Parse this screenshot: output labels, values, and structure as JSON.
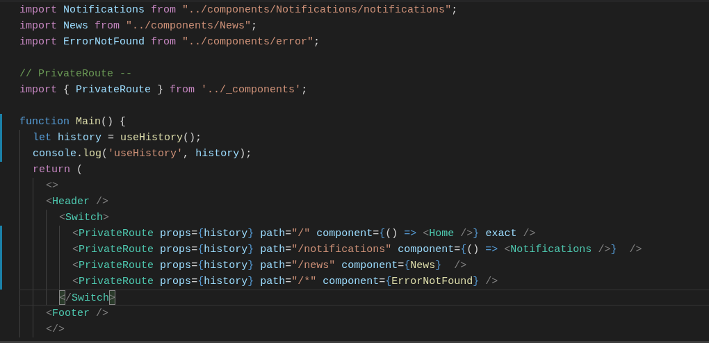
{
  "editor": {
    "lines": [
      {
        "changed": false,
        "current": false,
        "tokens": [
          {
            "text": "import",
            "kind": "keyword"
          },
          {
            "text": " Notifications",
            "kind": "variable"
          },
          {
            "text": " from",
            "kind": "keyword"
          },
          {
            "text": " \"../components/Notifications/notifications\"",
            "kind": "string"
          },
          {
            "text": ";",
            "kind": "punct"
          }
        ]
      },
      {
        "changed": false,
        "current": false,
        "tokens": [
          {
            "text": "import",
            "kind": "keyword"
          },
          {
            "text": " News",
            "kind": "variable"
          },
          {
            "text": " from",
            "kind": "keyword"
          },
          {
            "text": " \"../components/News\"",
            "kind": "string"
          },
          {
            "text": ";",
            "kind": "punct"
          }
        ]
      },
      {
        "changed": false,
        "current": false,
        "tokens": [
          {
            "text": "import",
            "kind": "keyword"
          },
          {
            "text": " ErrorNotFound",
            "kind": "variable"
          },
          {
            "text": " from",
            "kind": "keyword"
          },
          {
            "text": " \"../components/error\"",
            "kind": "string"
          },
          {
            "text": ";",
            "kind": "punct"
          }
        ]
      },
      {
        "changed": false,
        "current": false
      },
      {
        "changed": false,
        "current": false,
        "tokens": [
          {
            "text": "// PrivateRoute --",
            "kind": "comment"
          }
        ]
      },
      {
        "changed": false,
        "current": false,
        "tokens": [
          {
            "text": "import",
            "kind": "keyword"
          },
          {
            "text": " {",
            "kind": "punct"
          },
          {
            "text": " PrivateRoute",
            "kind": "variable"
          },
          {
            "text": " }",
            "kind": "punct"
          },
          {
            "text": " from",
            "kind": "keyword"
          },
          {
            "text": " '../_components'",
            "kind": "string"
          },
          {
            "text": ";",
            "kind": "punct"
          }
        ]
      },
      {
        "changed": false,
        "current": false
      },
      {
        "changed": true,
        "current": false,
        "tokens": [
          {
            "text": "function",
            "kind": "storage"
          },
          {
            "text": " Main",
            "kind": "func"
          },
          {
            "text": "() {",
            "kind": "punct"
          }
        ]
      },
      {
        "changed": true,
        "current": false,
        "tokens": [
          {
            "text": "  let",
            "kind": "storage"
          },
          {
            "text": " history",
            "kind": "variable"
          },
          {
            "text": " =",
            "kind": "punct"
          },
          {
            "text": " useHistory",
            "kind": "func"
          },
          {
            "text": "();",
            "kind": "punct"
          }
        ]
      },
      {
        "changed": true,
        "current": false,
        "tokens": [
          {
            "text": "  console",
            "kind": "variable"
          },
          {
            "text": ".",
            "kind": "punct"
          },
          {
            "text": "log",
            "kind": "func"
          },
          {
            "text": "(",
            "kind": "punct"
          },
          {
            "text": "'useHistory'",
            "kind": "string"
          },
          {
            "text": ", ",
            "kind": "punct"
          },
          {
            "text": "history",
            "kind": "variable"
          },
          {
            "text": ");",
            "kind": "punct"
          }
        ]
      },
      {
        "changed": false,
        "current": false,
        "tokens": [
          {
            "text": "  return",
            "kind": "keyword"
          },
          {
            "text": " (",
            "kind": "punct"
          }
        ]
      },
      {
        "changed": false,
        "current": false,
        "tokens": [
          {
            "text": "    <>",
            "kind": "tagpunct"
          }
        ]
      },
      {
        "changed": false,
        "current": false,
        "tokens": [
          {
            "text": "    <",
            "kind": "tagpunct"
          },
          {
            "text": "Header",
            "kind": "tag"
          },
          {
            "text": " />",
            "kind": "tagpunct"
          }
        ]
      },
      {
        "changed": false,
        "current": false,
        "tokens": [
          {
            "text": "      <",
            "kind": "tagpunct"
          },
          {
            "text": "Switch",
            "kind": "tag"
          },
          {
            "text": ">",
            "kind": "tagpunct"
          }
        ]
      },
      {
        "changed": true,
        "current": false,
        "tokens": [
          {
            "text": "        <",
            "kind": "tagpunct"
          },
          {
            "text": "PrivateRoute",
            "kind": "tag"
          },
          {
            "text": " props",
            "kind": "variable"
          },
          {
            "text": "=",
            "kind": "punct"
          },
          {
            "text": "{",
            "kind": "brace"
          },
          {
            "text": "history",
            "kind": "variable"
          },
          {
            "text": "}",
            "kind": "brace"
          },
          {
            "text": " path",
            "kind": "variable"
          },
          {
            "text": "=",
            "kind": "punct"
          },
          {
            "text": "\"/\"",
            "kind": "string"
          },
          {
            "text": " component",
            "kind": "variable"
          },
          {
            "text": "=",
            "kind": "punct"
          },
          {
            "text": "{",
            "kind": "brace"
          },
          {
            "text": "()",
            "kind": "punct"
          },
          {
            "text": " =>",
            "kind": "storage"
          },
          {
            "text": " <",
            "kind": "tagpunct"
          },
          {
            "text": "Home",
            "kind": "tag"
          },
          {
            "text": " />",
            "kind": "tagpunct"
          },
          {
            "text": "}",
            "kind": "brace"
          },
          {
            "text": " exact",
            "kind": "variable"
          },
          {
            "text": " />",
            "kind": "tagpunct"
          }
        ]
      },
      {
        "changed": true,
        "current": false,
        "tokens": [
          {
            "text": "        <",
            "kind": "tagpunct"
          },
          {
            "text": "PrivateRoute",
            "kind": "tag"
          },
          {
            "text": " props",
            "kind": "variable"
          },
          {
            "text": "=",
            "kind": "punct"
          },
          {
            "text": "{",
            "kind": "brace"
          },
          {
            "text": "history",
            "kind": "variable"
          },
          {
            "text": "}",
            "kind": "brace"
          },
          {
            "text": " path",
            "kind": "variable"
          },
          {
            "text": "=",
            "kind": "punct"
          },
          {
            "text": "\"/notifications\"",
            "kind": "string"
          },
          {
            "text": " component",
            "kind": "variable"
          },
          {
            "text": "=",
            "kind": "punct"
          },
          {
            "text": "{",
            "kind": "brace"
          },
          {
            "text": "()",
            "kind": "punct"
          },
          {
            "text": " =>",
            "kind": "storage"
          },
          {
            "text": " <",
            "kind": "tagpunct"
          },
          {
            "text": "Notifications",
            "kind": "tag"
          },
          {
            "text": " />",
            "kind": "tagpunct"
          },
          {
            "text": "}",
            "kind": "brace"
          },
          {
            "text": "  />",
            "kind": "tagpunct"
          }
        ]
      },
      {
        "changed": true,
        "current": false,
        "tokens": [
          {
            "text": "        <",
            "kind": "tagpunct"
          },
          {
            "text": "PrivateRoute",
            "kind": "tag"
          },
          {
            "text": " props",
            "kind": "variable"
          },
          {
            "text": "=",
            "kind": "punct"
          },
          {
            "text": "{",
            "kind": "brace"
          },
          {
            "text": "history",
            "kind": "variable"
          },
          {
            "text": "}",
            "kind": "brace"
          },
          {
            "text": " path",
            "kind": "variable"
          },
          {
            "text": "=",
            "kind": "punct"
          },
          {
            "text": "\"/news\"",
            "kind": "string"
          },
          {
            "text": " component",
            "kind": "variable"
          },
          {
            "text": "=",
            "kind": "punct"
          },
          {
            "text": "{",
            "kind": "brace"
          },
          {
            "text": "News",
            "kind": "func"
          },
          {
            "text": "}",
            "kind": "brace"
          },
          {
            "text": "  />",
            "kind": "tagpunct"
          }
        ]
      },
      {
        "changed": true,
        "current": false,
        "tokens": [
          {
            "text": "        <",
            "kind": "tagpunct"
          },
          {
            "text": "PrivateRoute",
            "kind": "tag"
          },
          {
            "text": " props",
            "kind": "variable"
          },
          {
            "text": "=",
            "kind": "punct"
          },
          {
            "text": "{",
            "kind": "brace"
          },
          {
            "text": "history",
            "kind": "variable"
          },
          {
            "text": "}",
            "kind": "brace"
          },
          {
            "text": " path",
            "kind": "variable"
          },
          {
            "text": "=",
            "kind": "punct"
          },
          {
            "text": "\"/*\"",
            "kind": "string"
          },
          {
            "text": " component",
            "kind": "variable"
          },
          {
            "text": "=",
            "kind": "punct"
          },
          {
            "text": "{",
            "kind": "brace"
          },
          {
            "text": "ErrorNotFound",
            "kind": "func"
          },
          {
            "text": "}",
            "kind": "brace"
          },
          {
            "text": " />",
            "kind": "tagpunct"
          }
        ]
      },
      {
        "changed": false,
        "current": true,
        "tokens": [
          {
            "text": "      <",
            "kind": "tagpunct",
            "matched": true
          },
          {
            "text": "/",
            "kind": "tagpunct"
          },
          {
            "text": "Switch",
            "kind": "tag"
          },
          {
            "text": ">",
            "kind": "tagpunct",
            "matched": true
          }
        ]
      },
      {
        "changed": false,
        "current": false,
        "tokens": [
          {
            "text": "    <",
            "kind": "tagpunct"
          },
          {
            "text": "Footer",
            "kind": "tag"
          },
          {
            "text": " />",
            "kind": "tagpunct"
          }
        ]
      },
      {
        "changed": false,
        "current": false,
        "tokens": [
          {
            "text": "    </>",
            "kind": "tagpunct"
          }
        ]
      }
    ]
  }
}
